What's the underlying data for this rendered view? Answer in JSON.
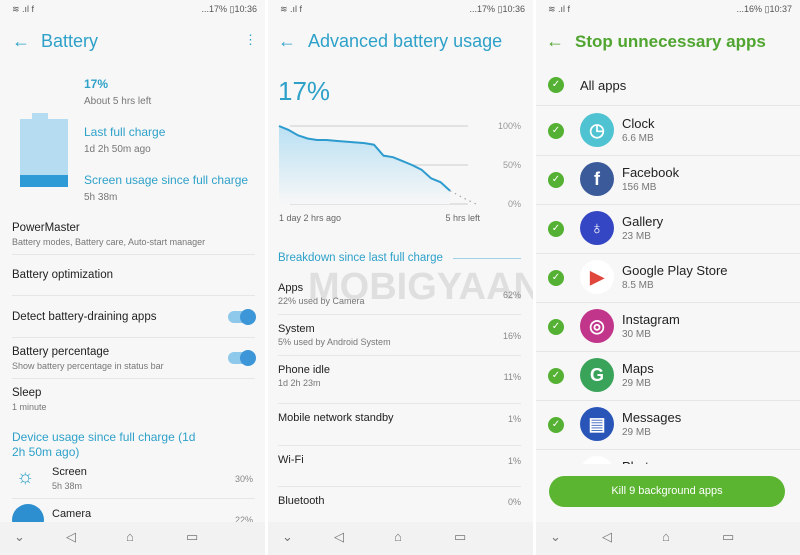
{
  "watermark": "MOBIGYAAN",
  "battery": {
    "status": {
      "left": "≋ .ıl f",
      "right": "...17% ▯10:36"
    },
    "title": "Battery",
    "percent": "17%",
    "time_left": "About 5 hrs left",
    "last_full_label": "Last full charge",
    "last_full_value": "1d 2h 50m ago",
    "screen_label": "Screen usage since full charge",
    "screen_value": "5h 38m",
    "level_percent": 17,
    "items": [
      {
        "label": "PowerMaster",
        "sub": "Battery modes, Battery care, Auto-start manager"
      },
      {
        "label": "Battery optimization"
      },
      {
        "label": "Detect battery-draining apps",
        "toggle": true
      },
      {
        "label": "Battery percentage",
        "sub": "Show battery percentage in status bar",
        "toggle": true
      },
      {
        "label": "Sleep",
        "sub": "1 minute"
      }
    ],
    "usage_heading": "Device usage since full charge (1d 2h 50m ago)",
    "usage": [
      {
        "label": "Screen",
        "sub": "5h 38m",
        "pct": "30%",
        "icon": "brightness-icon"
      },
      {
        "label": "Camera",
        "pct": "22%",
        "icon": "camera-icon"
      }
    ]
  },
  "advanced": {
    "status": {
      "left": "≋ .ıl f",
      "right": "...17% ▯10:36"
    },
    "title": "Advanced battery usage",
    "percent": "17%",
    "breakdown_heading": "Breakdown since last full charge",
    "rows": [
      {
        "label": "Apps",
        "sub": "22% used by Camera",
        "pct": "62%"
      },
      {
        "label": "System",
        "sub": "5% used by Android System",
        "pct": "16%"
      },
      {
        "label": "Phone idle",
        "sub": "1d 2h 23m",
        "pct": "11%"
      },
      {
        "label": "Mobile network standby",
        "pct": "1%"
      },
      {
        "label": "Wi-Fi",
        "pct": "1%"
      },
      {
        "label": "Bluetooth",
        "pct": "0%"
      }
    ]
  },
  "chart_data": {
    "type": "line",
    "x_tick_labels": [
      "1 day 2 hrs ago",
      "5 hrs left"
    ],
    "y_tick_labels": [
      "100%",
      "50%",
      "0%"
    ],
    "ylim": [
      0,
      100
    ],
    "grid": true,
    "series": [
      {
        "values": [
          100,
          95,
          88,
          84,
          82,
          82,
          81,
          80,
          79,
          78,
          76,
          62,
          60,
          55,
          50,
          44,
          33,
          28,
          17
        ]
      },
      {
        "style": "dotted-projection",
        "values": [
          17,
          8,
          0
        ]
      }
    ],
    "color": "#2e9bcf"
  },
  "stop": {
    "status": {
      "left": "≋ .ıl f",
      "right": "...16% ▯10:37"
    },
    "title": "Stop unnecessary apps",
    "all_label": "All apps",
    "apps": [
      {
        "name": "Clock",
        "size": "6.6 MB",
        "color": "#4fc3d1",
        "glyph": "◷"
      },
      {
        "name": "Facebook",
        "size": "156 MB",
        "color": "#3b5a9a",
        "glyph": "f"
      },
      {
        "name": "Gallery",
        "size": "23 MB",
        "color": "#3546c4",
        "glyph": "♁"
      },
      {
        "name": "Google Play Store",
        "size": "8.5 MB",
        "color": "#ffffff",
        "glyph": "▶"
      },
      {
        "name": "Instagram",
        "size": "30 MB",
        "color": "#c1358a",
        "glyph": "◎"
      },
      {
        "name": "Maps",
        "size": "29 MB",
        "color": "#3aa35a",
        "glyph": "G"
      },
      {
        "name": "Messages",
        "size": "29 MB",
        "color": "#2a55b8",
        "glyph": "▤"
      },
      {
        "name": "Photos",
        "size": "",
        "color": "#ffffff",
        "glyph": "✦"
      }
    ],
    "kill_button": "Kill 9 background apps"
  },
  "nav": {
    "down": "⌄",
    "back": "◁",
    "home": "⌂",
    "recent": "▭"
  }
}
